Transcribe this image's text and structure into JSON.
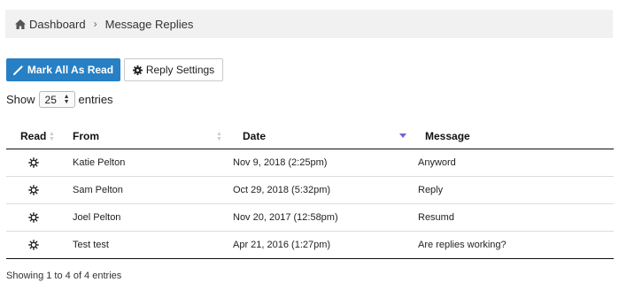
{
  "breadcrumb": {
    "home_icon": "home-icon",
    "home_label": "Dashboard",
    "separator": "›",
    "current_label": "Message Replies"
  },
  "toolbar": {
    "mark_read_icon": "magic-wand-icon",
    "mark_read_label": "Mark All As Read",
    "mark_read_color": "#2780c4",
    "settings_icon": "gear-icon",
    "settings_label": "Reply Settings"
  },
  "length": {
    "prefix": "Show",
    "selected": "25",
    "suffix": "entries"
  },
  "table": {
    "columns": [
      {
        "label": "Read",
        "sort": "both"
      },
      {
        "label": "From",
        "sort": "both"
      },
      {
        "label": "Date",
        "sort": "desc"
      },
      {
        "label": "Message",
        "sort": "none"
      }
    ],
    "rows": [
      {
        "read_icon": "unread-sun-icon",
        "from": "Katie Pelton",
        "date": "Nov 9, 2018 (2:25pm)",
        "message": "Anyword"
      },
      {
        "read_icon": "unread-sun-icon",
        "from": "Sam Pelton",
        "date": "Oct 29, 2018 (5:32pm)",
        "message": "Reply"
      },
      {
        "read_icon": "unread-sun-icon",
        "from": "Joel Pelton",
        "date": "Nov 20, 2017 (12:58pm)",
        "message": "Resumd"
      },
      {
        "read_icon": "unread-sun-icon",
        "from": "Test test",
        "date": "Apr 21, 2016 (1:27pm)",
        "message": "Are replies working?"
      }
    ],
    "sort_accent": "#7b5cd6"
  },
  "info": "Showing 1 to 4 of 4 entries"
}
